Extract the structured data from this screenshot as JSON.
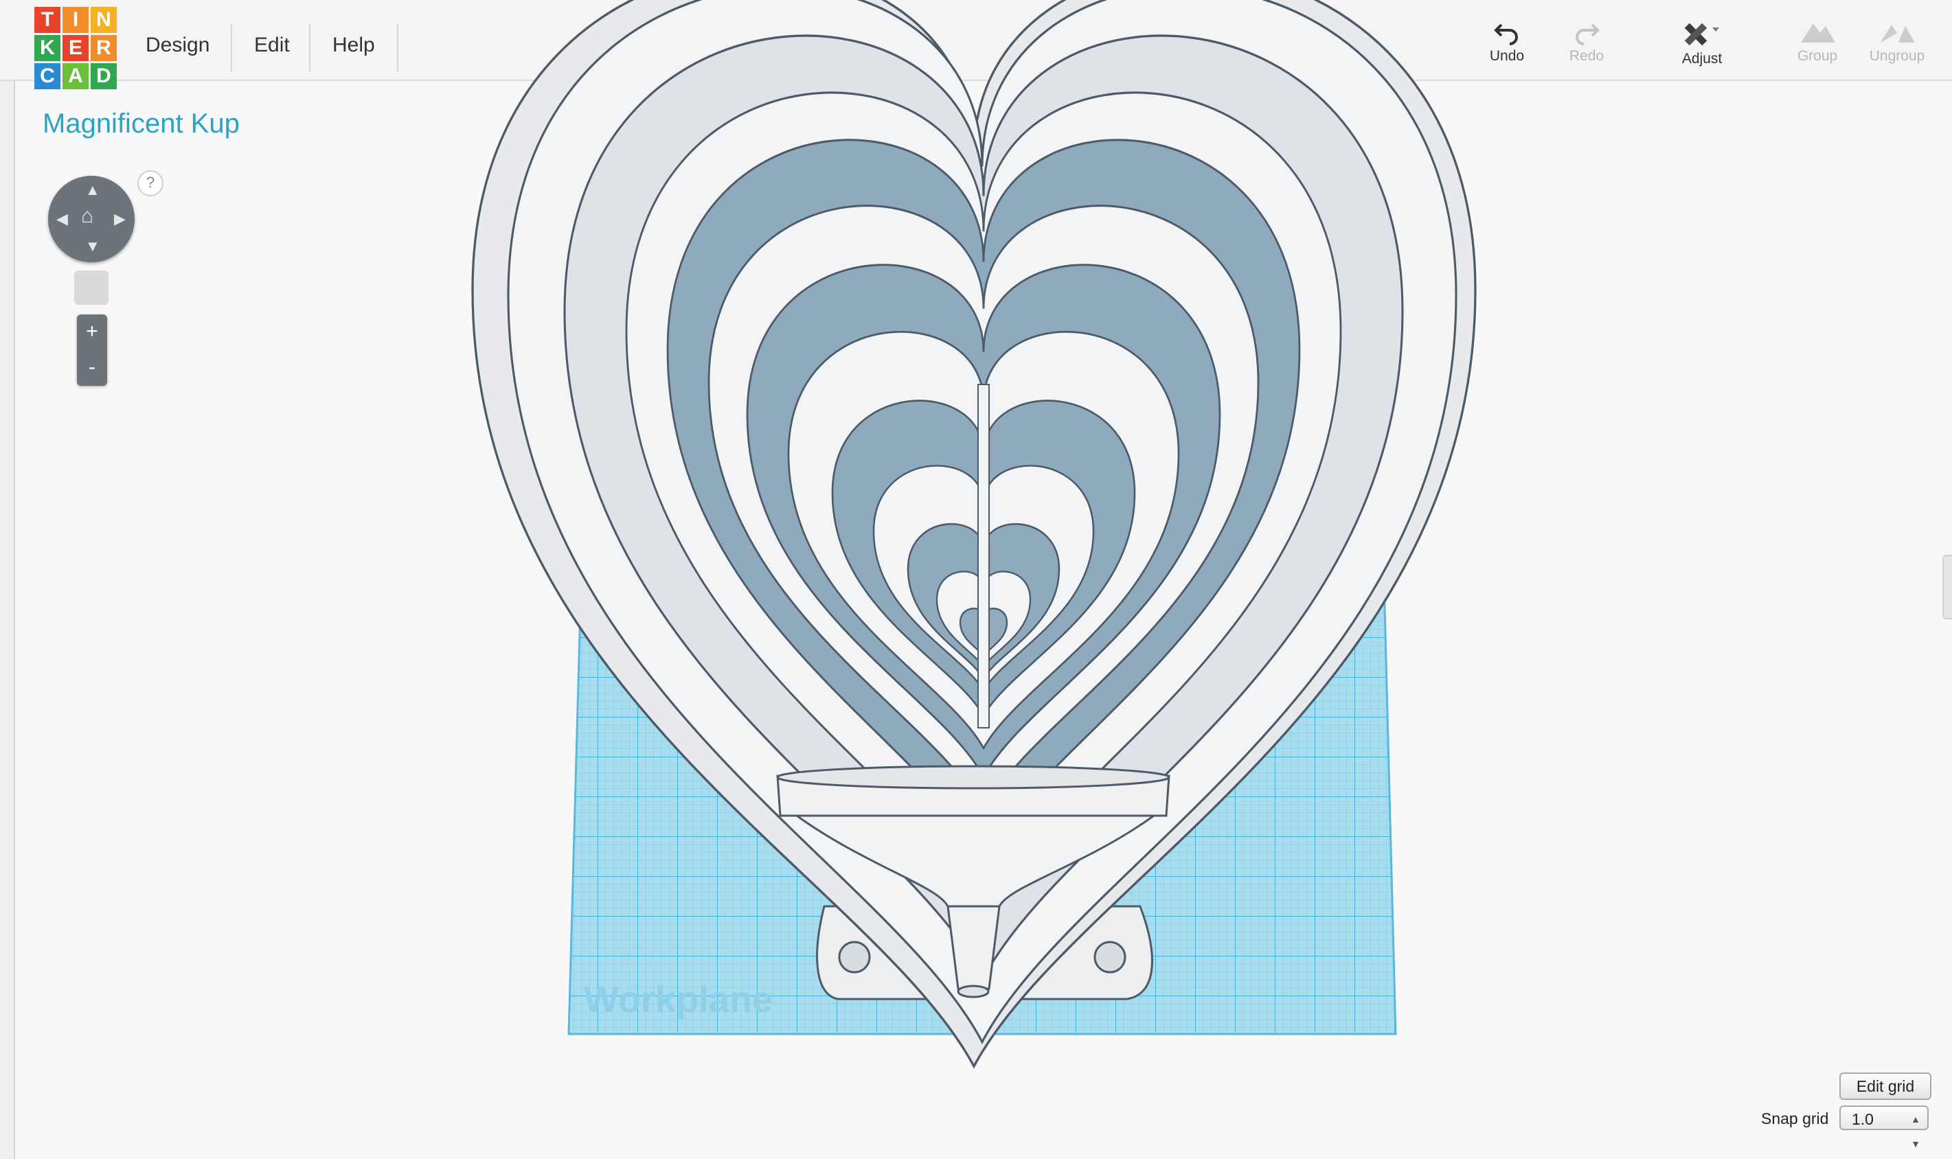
{
  "app": {
    "logo_letters": [
      "T",
      "I",
      "N",
      "K",
      "E",
      "R",
      "C",
      "A",
      "D"
    ],
    "logo_colors": [
      "#e8442a",
      "#f28c28",
      "#f6b125",
      "#2fa84f",
      "#e8442a",
      "#f28c28",
      "#2a8bd2",
      "#6bbf3b",
      "#2fa84f"
    ]
  },
  "menu": {
    "design": "Design",
    "edit": "Edit",
    "help": "Help"
  },
  "toolbar": {
    "undo": "Undo",
    "redo": "Redo",
    "adjust": "Adjust",
    "group": "Group",
    "ungroup": "Ungroup"
  },
  "design_title": "Magnificent Kup",
  "viewport": {
    "help": "?",
    "zoom_in": "+",
    "zoom_out": "-",
    "workplane_label": "Workplane"
  },
  "grid": {
    "edit_grid": "Edit grid",
    "snap_label": "Snap grid",
    "snap_value": "1.0"
  },
  "colors": {
    "accent": "#2ba3c4",
    "workplane": "#9fd8ec",
    "grid_line": "#6cc3e3"
  }
}
